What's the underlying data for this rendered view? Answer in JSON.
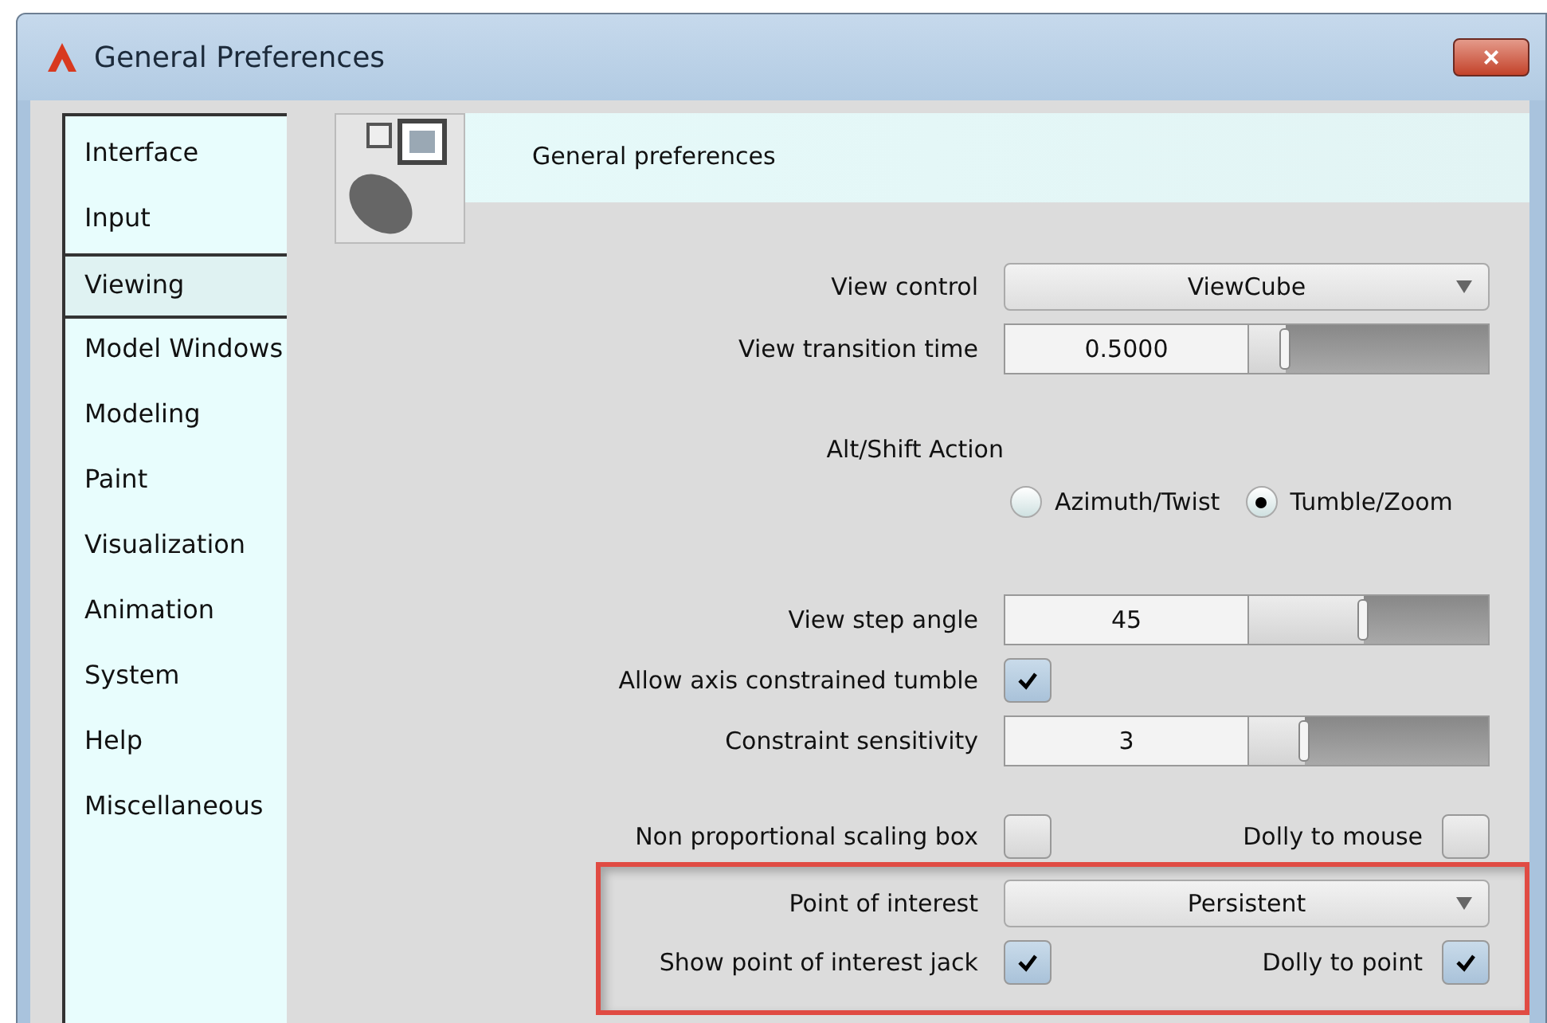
{
  "window": {
    "title": "General Preferences",
    "close": "×"
  },
  "sidebar": {
    "items": [
      {
        "label": "Interface",
        "selected": false
      },
      {
        "label": "Input",
        "selected": false
      },
      {
        "label": "Viewing",
        "selected": true
      },
      {
        "label": "Model Windows",
        "selected": false
      },
      {
        "label": "Modeling",
        "selected": false
      },
      {
        "label": "Paint",
        "selected": false
      },
      {
        "label": "Visualization",
        "selected": false
      },
      {
        "label": "Animation",
        "selected": false
      },
      {
        "label": "System",
        "selected": false
      },
      {
        "label": "Help",
        "selected": false
      },
      {
        "label": "Miscellaneous",
        "selected": false
      }
    ]
  },
  "header": {
    "title": "General preferences"
  },
  "settings": [
    {
      "kind": "dropdown",
      "label": "View control",
      "value": "ViewCube"
    },
    {
      "kind": "slider",
      "label": "View transition time",
      "value": "0.5000",
      "level": 0.15
    },
    {
      "kind": "heading",
      "label": "Alt/Shift Action"
    },
    {
      "kind": "radios",
      "options": [
        {
          "label": "Azimuth/Twist",
          "selected": false
        },
        {
          "label": "Tumble/Zoom",
          "selected": true
        }
      ]
    },
    {
      "kind": "slider",
      "label": "View step angle",
      "value": "45",
      "level": 0.48
    },
    {
      "kind": "checkbox",
      "label": "Allow axis constrained tumble",
      "checked": true
    },
    {
      "kind": "slider",
      "label": "Constraint sensitivity",
      "value": "3",
      "level": 0.23
    },
    {
      "kind": "pair",
      "label": "Non proportional scaling box",
      "checked": false,
      "label2": "Dolly to mouse",
      "checked2": false
    }
  ],
  "highlighted": [
    {
      "kind": "dropdown",
      "label": "Point of interest",
      "value": "Persistent"
    },
    {
      "kind": "pair",
      "label": "Show point of interest jack",
      "checked": true,
      "label2": "Dolly to point",
      "checked2": true
    }
  ]
}
